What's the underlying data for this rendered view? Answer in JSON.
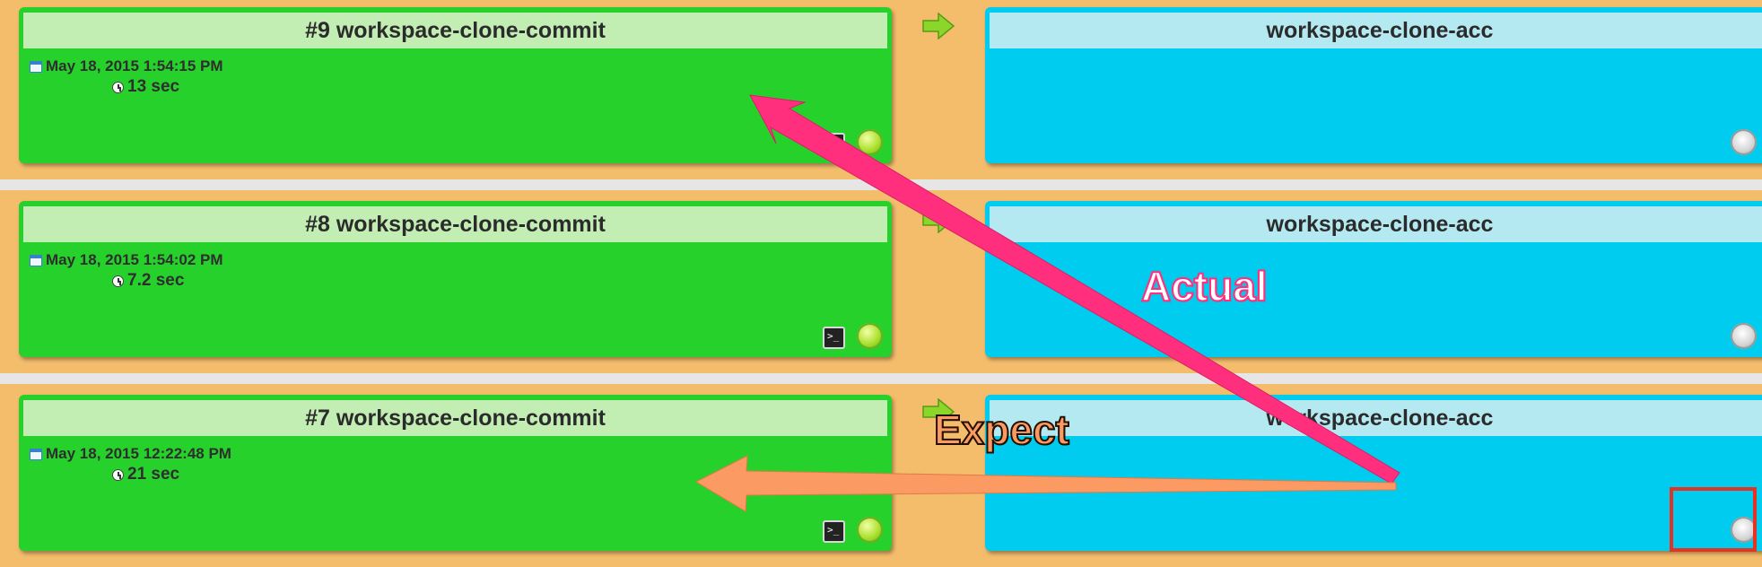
{
  "rows": [
    {
      "build": {
        "title": "#9 workspace-clone-commit",
        "date": "May 18, 2015 1:54:15 PM",
        "duration": "13 sec",
        "icons": [
          "calendar-icon",
          "clock-icon",
          "console-icon",
          "rebuild-icon"
        ]
      },
      "downstream": {
        "title": "workspace-clone-acc",
        "icons": [
          "trigger-build-icon"
        ]
      }
    },
    {
      "build": {
        "title": "#8 workspace-clone-commit",
        "date": "May 18, 2015 1:54:02 PM",
        "duration": "7.2 sec",
        "icons": [
          "calendar-icon",
          "clock-icon",
          "console-icon",
          "rebuild-icon"
        ]
      },
      "downstream": {
        "title": "workspace-clone-acc",
        "icons": [
          "trigger-build-icon"
        ]
      }
    },
    {
      "build": {
        "title": "#7 workspace-clone-commit",
        "date": "May 18, 2015 12:22:48 PM",
        "duration": "21 sec",
        "icons": [
          "calendar-icon",
          "clock-icon",
          "console-icon",
          "rebuild-icon"
        ]
      },
      "downstream": {
        "title": "workspace-clone-acc",
        "icons": [
          "trigger-build-icon"
        ]
      }
    }
  ],
  "annotations": {
    "actual_label": "Actual",
    "expect_label": "Expect"
  },
  "colors": {
    "background": "#f3bd6c",
    "success_card": "#27d12b",
    "success_header": "#c2eeb4",
    "pending_card": "#00ccef",
    "pending_header": "#b5e9f1",
    "actual_arrow": "#ff2f7e",
    "expect_arrow": "#fc9a63",
    "highlight_box": "#e63222"
  }
}
